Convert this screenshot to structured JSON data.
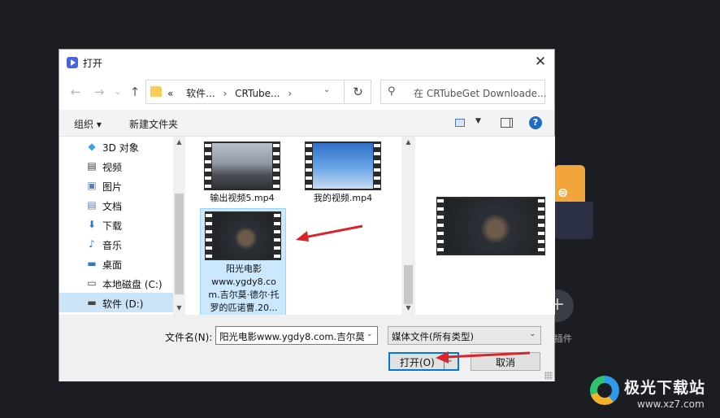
{
  "background": {
    "plugin_label": "插件",
    "plus_label": "+"
  },
  "dialog": {
    "title": "打开",
    "close_glyph": "✕",
    "nav": {
      "back": "←",
      "forward": "→",
      "recent": "⌄",
      "up": "↑"
    },
    "address": {
      "overflow": "«",
      "crumb1": "软件...",
      "crumb2": "CRTube...",
      "sep": "›",
      "dropdown": "⌄",
      "refresh": "↻"
    },
    "search": {
      "placeholder": "在 CRTubeGet Downloade..."
    },
    "toolbar": {
      "organize": "组织 ▾",
      "new_folder": "新建文件夹",
      "help": "?",
      "view_dd": "▼"
    },
    "tree": [
      {
        "icon": "cube-3d-icon",
        "glyph": "◆",
        "label": "3D 对象",
        "color": "#3aa3e8"
      },
      {
        "icon": "video-icon",
        "glyph": "▤",
        "label": "视频",
        "color": "#3a3a3a"
      },
      {
        "icon": "picture-icon",
        "glyph": "▣",
        "label": "图片",
        "color": "#5a7fb0"
      },
      {
        "icon": "document-icon",
        "glyph": "▤",
        "label": "文档",
        "color": "#5a7fb0"
      },
      {
        "icon": "download-icon",
        "glyph": "⬇",
        "label": "下载",
        "color": "#2a78d0"
      },
      {
        "icon": "music-icon",
        "glyph": "♪",
        "label": "音乐",
        "color": "#2a78d0"
      },
      {
        "icon": "desktop-icon",
        "glyph": "▬",
        "label": "桌面",
        "color": "#2a78d0"
      },
      {
        "icon": "drive-c-icon",
        "glyph": "▭",
        "label": "本地磁盘 (C:)",
        "color": "#444"
      },
      {
        "icon": "drive-d-icon",
        "glyph": "▬",
        "label": "软件 (D:)",
        "color": "#444",
        "selected": true
      }
    ],
    "files": [
      {
        "name": "输出视频5.mp4",
        "selected": false
      },
      {
        "name": "我的视频.mp4",
        "selected": false
      },
      {
        "name_lines": [
          "阳光电影",
          "www.ygdy8.co",
          "m.吉尔莫·德尔·托",
          "罗的匹诺曹.20..."
        ],
        "selected": true
      }
    ],
    "footer": {
      "filename_label": "文件名(N):",
      "filename_value": "阳光电影www.ygdy8.com.吉尔莫",
      "filetype": "媒体文件(所有类型)",
      "open_label": "打开(O)",
      "cancel_label": "取消",
      "dd": "⌄"
    }
  },
  "scroll": {
    "up": "▲",
    "down": "▼"
  },
  "watermark": {
    "brand": "极光下载站",
    "url": "www.xz7.com"
  },
  "colors": {
    "accent": "#0078d7",
    "selection": "#cce8ff",
    "annotation": "#d9252a"
  }
}
